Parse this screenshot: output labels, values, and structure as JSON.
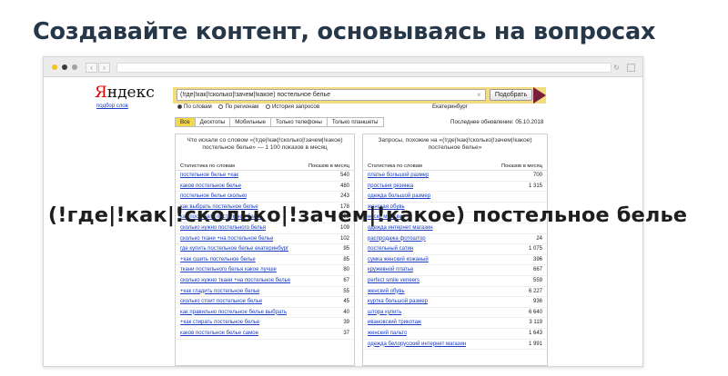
{
  "slide_title": "Создавайте контент, основываясь на вопросах",
  "overlay_text": "(!где|!как|!сколько|!зачем|!какое) постельное белье",
  "logo": {
    "first": "Я",
    "rest": "ндекс"
  },
  "wordstat_link": "подбор слов",
  "search": {
    "query": "(!где|!как|!сколько|!зачем|!какое) постельное белье",
    "button_label": "Подобрать",
    "clear_icon": "×"
  },
  "radios": [
    {
      "label": "По словам",
      "selected": true
    },
    {
      "label": "По регионам",
      "selected": false
    },
    {
      "label": "История запросов",
      "selected": false
    }
  ],
  "region": "Екатеринбург",
  "tabs": [
    "Все",
    "Десктопы",
    "Мобильные",
    "Только телефоны",
    "Только планшеты"
  ],
  "last_updated": "Последнее обновление: 05.10.2018",
  "left_panel": {
    "title": "Что искали со словом «(!где|!как|!сколько|!зачем|!какое) постельное белье» — 1 100 показов в месяц",
    "col_keyword": "Статистика по словам",
    "col_count": "Показов в месяц",
    "rows": [
      {
        "kw": "постельное белье +как",
        "n": "540"
      },
      {
        "kw": "каков постельное белье",
        "n": "480"
      },
      {
        "kw": "постельное белье сколько",
        "n": "243"
      },
      {
        "kw": "как выбрать постельное белье",
        "n": "178"
      },
      {
        "kw": "как постирать постельное белье",
        "n": "128"
      },
      {
        "kw": "сколько нужно постельного белья",
        "n": "109"
      },
      {
        "kw": "сколько ткани +на постельное белье",
        "n": "102"
      },
      {
        "kw": "где купить постельное белье екатеринбург",
        "n": "95"
      },
      {
        "kw": "+как сшить постельное белье",
        "n": "85"
      },
      {
        "kw": "ткани постельного белья какое лучше",
        "n": "80"
      },
      {
        "kw": "сколько нужно ткани +на постельное белье",
        "n": "67"
      },
      {
        "kw": "+как гладить постельное белье",
        "n": "55"
      },
      {
        "kw": "сколько стоит постельное белье",
        "n": "45"
      },
      {
        "kw": "как правильно постельное белье выбрать",
        "n": "40"
      },
      {
        "kw": "+как стирать постельное белье",
        "n": "39"
      },
      {
        "kw": "каков постельное белье самое",
        "n": "37"
      }
    ]
  },
  "right_panel": {
    "title": "Запросы, похожие на «(!где|!как|!сколько|!зачем|!какое) постельное белье»",
    "col_keyword": "Статистика по словам",
    "col_count": "Показов в месяц",
    "rows": [
      {
        "kw": "платье большой размер",
        "n": "700"
      },
      {
        "kw": "простыня резинка",
        "n": "1 315"
      },
      {
        "kw": "одежда большой размер",
        "n": ""
      },
      {
        "kw": "женская обувь",
        "n": ""
      },
      {
        "kw": "носки мужские",
        "n": ""
      },
      {
        "kw": "одежда интернет магазин",
        "n": ""
      },
      {
        "kw": "распродажа фотоштор",
        "n": "24"
      },
      {
        "kw": "постельный сатин",
        "n": "1 075"
      },
      {
        "kw": "сумка женский кожаный",
        "n": "396"
      },
      {
        "kw": "кружевной платье",
        "n": "667"
      },
      {
        "kw": "perfect smile veneers",
        "n": "559"
      },
      {
        "kw": "женский обувь",
        "n": "6 227"
      },
      {
        "kw": "куртка большой размер",
        "n": "936"
      },
      {
        "kw": "штора купить",
        "n": "6 640"
      },
      {
        "kw": "ивановский трикотаж",
        "n": "3 119"
      },
      {
        "kw": "женский пальто",
        "n": "1 643"
      },
      {
        "kw": "одежда белорусский интернет магазин",
        "n": "1 991"
      }
    ]
  }
}
